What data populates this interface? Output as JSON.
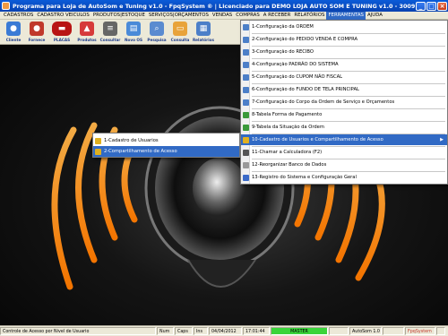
{
  "window": {
    "title": "Programa para Loja de AutoSom e Tuning v1.0 - FpqSystem ® | Licenciado para  DEMO LOJA AUTO SOM E TUNING v1.0 - 300912 010412"
  },
  "menubar": {
    "items": [
      {
        "label": "CADASTROS"
      },
      {
        "label": "CADASTRO VEICULOS"
      },
      {
        "label": "PRODUTOS|ESTOQUE"
      },
      {
        "label": "SERVIÇOS|ORÇAMENTOS"
      },
      {
        "label": "VENDAS"
      },
      {
        "label": "COMPRAS"
      },
      {
        "label": "A RECEBER"
      },
      {
        "label": "RELATÓRIOS"
      },
      {
        "label": "FERRAMENTAS"
      },
      {
        "label": "AJUDA"
      }
    ]
  },
  "toolbar": {
    "buttons": [
      {
        "label": "Cliente",
        "icon": "person-icon",
        "color": "#3a7bd5"
      },
      {
        "label": "Fornece",
        "icon": "supplier-icon",
        "color": "#c0392b"
      },
      {
        "label": "PLACAS",
        "icon": "car-icon",
        "color": "#b81414"
      },
      {
        "label": "Produtos",
        "icon": "product-icon",
        "color": "#d63a3a"
      },
      {
        "label": "Consultar",
        "icon": "search-stack-icon",
        "color": "#666666"
      },
      {
        "label": "Novo OS",
        "icon": "new-order-icon",
        "color": "#4a8ad8"
      },
      {
        "label": "Pesquisa",
        "icon": "search-doc-icon",
        "color": "#5a8bd0"
      },
      {
        "label": "Consulta",
        "icon": "folder-icon",
        "color": "#e8a33a"
      },
      {
        "label": "Relatórios",
        "icon": "report-icon",
        "color": "#4c7fc8"
      }
    ]
  },
  "ferramentas_menu": {
    "items": [
      {
        "label": "1-Configuração da ORDEM",
        "icon": "doc-icon",
        "color": "#4c7fc8"
      },
      {
        "label": "2-Configuração do PEDIDO VENDA E COMPRA",
        "icon": "doc-icon",
        "color": "#4c7fc8"
      },
      {
        "label": "3-Configuração do RECIBO",
        "icon": "doc-icon",
        "color": "#4c7fc8"
      },
      {
        "label": "4-Configuração PADRÃO DO SISTEMA",
        "icon": "doc-icon",
        "color": "#4c7fc8"
      },
      {
        "label": "5-Configuração do CUPOM NÃO FISCAL",
        "icon": "doc-icon",
        "color": "#4c7fc8"
      },
      {
        "label": "6-Configuração do FUNDO DE TELA PRINCIPAL",
        "icon": "doc-icon",
        "color": "#4c7fc8"
      },
      {
        "label": "7-Configuração do Corpo da Ordem de Serviço e Orçamentos",
        "icon": "doc-icon",
        "color": "#4c7fc8"
      },
      {
        "label": "8-Tabela Forma de Pagamento",
        "icon": "money-icon",
        "color": "#3a9a3a"
      },
      {
        "label": "9-Tabela da Situação da Ordem",
        "icon": "table-icon",
        "color": "#3a9a3a"
      },
      {
        "label": "10-Cadastro de Usuarios e Compartilhamento de Acesso",
        "icon": "users-icon",
        "color": "#e0b020"
      },
      {
        "label": "11-Chamar a Calculadora (F2)",
        "icon": "calculator-icon",
        "color": "#555555"
      },
      {
        "label": "12-Reorganizar Banco de Dados",
        "icon": "database-icon",
        "color": "#999999"
      },
      {
        "label": "13-Registro do Sistema e Configuração Geral",
        "icon": "key-icon",
        "color": "#3a6ac8"
      }
    ]
  },
  "usuarios_submenu": {
    "items": [
      {
        "label": "1-Cadastro de Usuarios",
        "icon": "user-icon",
        "color": "#e0b020"
      },
      {
        "label": "2-Compartilhamento de Acesso",
        "icon": "share-icon",
        "color": "#e0b020"
      }
    ]
  },
  "statusbar": {
    "message": "Controle de Acesso por Nivel de Usuario",
    "num": "Num",
    "caps": "Caps",
    "ins": "Ins",
    "date": "04/04/2012",
    "time": "17:01:44",
    "user": "MASTER",
    "version": "AutoSom 1.0",
    "brand": "FpqSystem"
  },
  "colors": {
    "titlebar": "#0a5bd8",
    "menu_highlight": "#316ac5",
    "speaker_glow": "#ff8c1a",
    "status_user": "#3ad43a"
  }
}
